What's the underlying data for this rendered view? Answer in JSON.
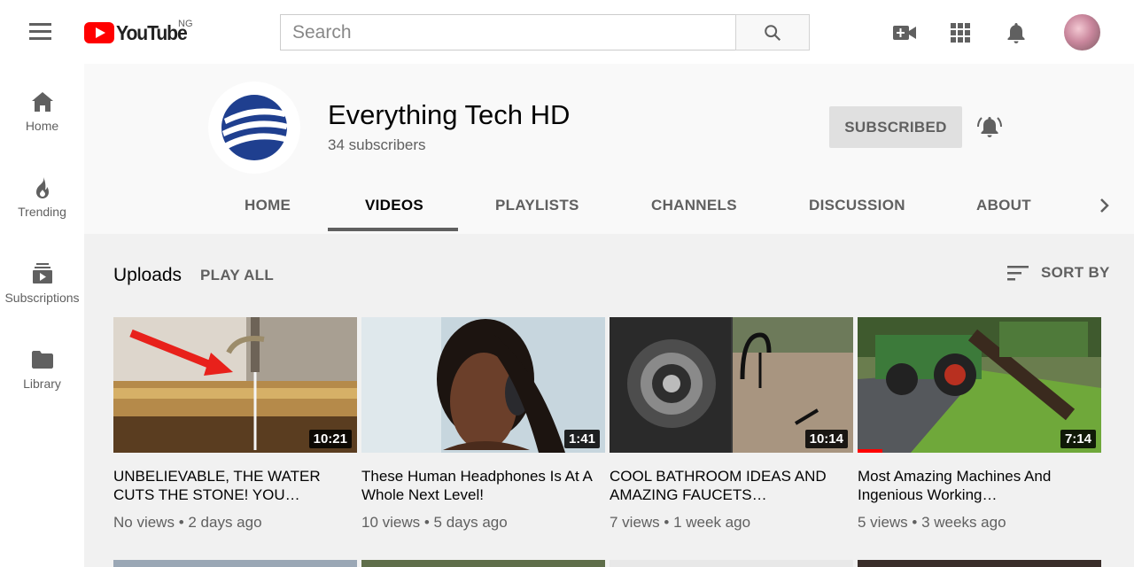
{
  "app": {
    "logo_text": "YouTube",
    "country_code": "NG"
  },
  "search": {
    "placeholder": "Search"
  },
  "sidebar": {
    "items": [
      {
        "label": "Home",
        "icon": "home-icon"
      },
      {
        "label": "Trending",
        "icon": "trending-icon"
      },
      {
        "label": "Subscriptions",
        "icon": "subscriptions-icon"
      },
      {
        "label": "Library",
        "icon": "library-icon"
      }
    ]
  },
  "channel": {
    "name": "Everything Tech HD",
    "subscribers": "34 subscribers",
    "subscribe_label": "SUBSCRIBED",
    "brand_color": "#1f3f8f"
  },
  "tabs": [
    {
      "label": "HOME",
      "active": false
    },
    {
      "label": "VIDEOS",
      "active": true
    },
    {
      "label": "PLAYLISTS",
      "active": false
    },
    {
      "label": "CHANNELS",
      "active": false
    },
    {
      "label": "DISCUSSION",
      "active": false
    },
    {
      "label": "ABOUT",
      "active": false
    }
  ],
  "uploads": {
    "title": "Uploads",
    "play_all": "PLAY ALL",
    "sort_by": "SORT BY"
  },
  "videos": [
    {
      "title": "UNBELIEVABLE, THE WATER CUTS THE STONE! YOU…",
      "duration": "10:21",
      "views": "No views",
      "age": "2 days ago"
    },
    {
      "title": "These Human Headphones Is At A Whole Next Level!",
      "duration": "1:41",
      "views": "10 views",
      "age": "5 days ago"
    },
    {
      "title": "COOL BATHROOM IDEAS AND AMAZING FAUCETS…",
      "duration": "10:14",
      "views": "7 views",
      "age": "1 week ago"
    },
    {
      "title": "Most Amazing Machines And Ingenious Working…",
      "duration": "7:14",
      "views": "5 views",
      "age": "3 weeks ago",
      "watched_fraction": 0.1
    }
  ],
  "colors": {
    "accent": "#ff0000",
    "text_secondary": "#606060"
  }
}
